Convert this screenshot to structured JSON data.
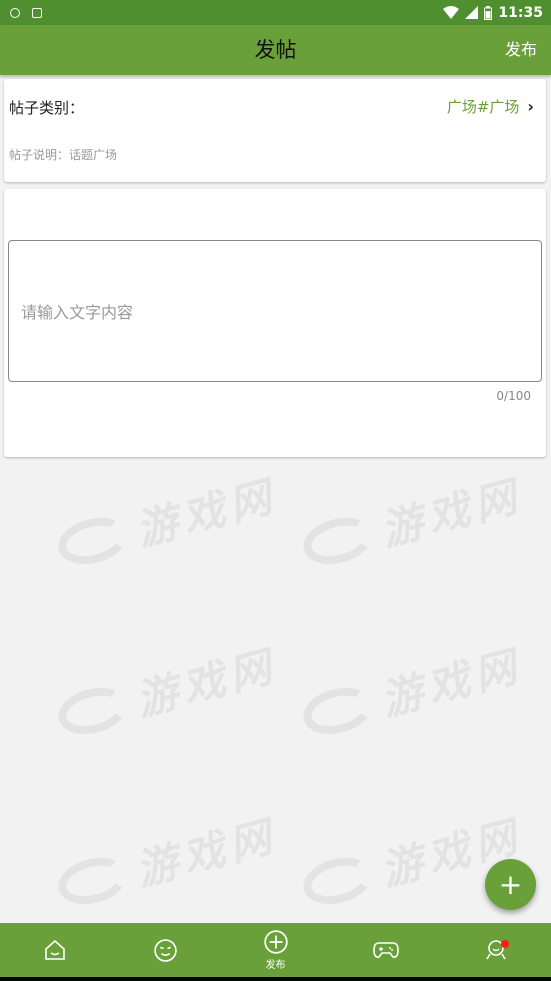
{
  "status_bar": {
    "time": "11:35",
    "left_icons": [
      "shield-icon",
      "android-icon"
    ],
    "right_icons": [
      "wifi-icon",
      "signal-icon",
      "battery-icon"
    ]
  },
  "toolbar": {
    "title": "发帖",
    "publish_label": "发布"
  },
  "category": {
    "label": "帖子类别：",
    "value": "广场#广场",
    "description": "帖子说明：话题广场"
  },
  "editor": {
    "placeholder": "请输入文字内容",
    "value": "",
    "counter": "0/100"
  },
  "watermark_text": "游戏网",
  "fab": {
    "icon": "plus-icon"
  },
  "bottom_nav": {
    "items": [
      {
        "name": "home",
        "icon": "home-icon",
        "label": ""
      },
      {
        "name": "emoji",
        "icon": "smiley-icon",
        "label": ""
      },
      {
        "name": "publish",
        "icon": "add-circle-icon",
        "label": "发布"
      },
      {
        "name": "game",
        "icon": "gamepad-icon",
        "label": ""
      },
      {
        "name": "profile",
        "icon": "user-icon",
        "label": ""
      }
    ]
  },
  "colors": {
    "primary": "#6aa03a",
    "status_bar": "#4f8f30",
    "badge": "#ff1a1a"
  }
}
